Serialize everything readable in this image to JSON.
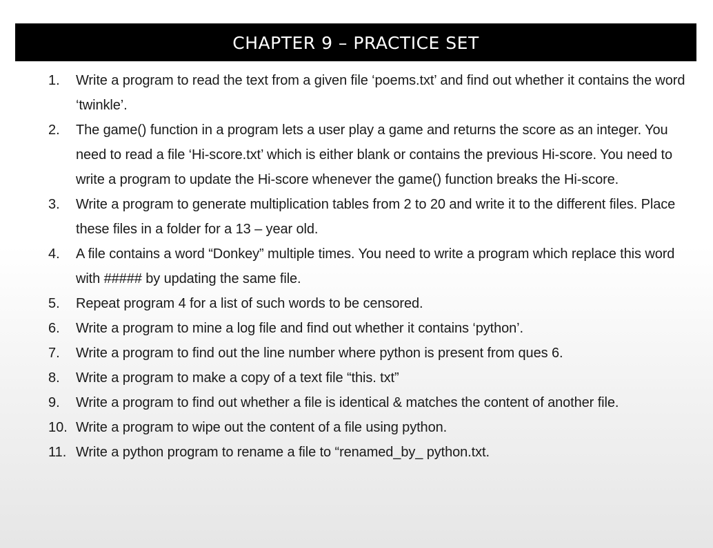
{
  "title": "CHAPTER 9 – PRACTICE SET",
  "questions": [
    {
      "number": "1.",
      "text": "Write a program to read the text from a given file ‘poems.txt’ and find out whether it contains the word ‘twinkle’."
    },
    {
      "number": "2.",
      "text": "The game() function in a program lets a user play a game and returns the score as an integer. You need to read a file ‘Hi-score.txt’ which is either blank or contains the previous Hi-score. You need to write a program to update the Hi-score whenever the game() function breaks the Hi-score."
    },
    {
      "number": "3.",
      "text": "Write a program to generate multiplication tables from 2 to 20 and write it to the different files. Place these files in a folder for a 13 – year old."
    },
    {
      "number": "4.",
      "text": "A file contains a word “Donkey” multiple times. You need to write a program which replace this word with ##### by updating the same file."
    },
    {
      "number": "5.",
      "text": "Repeat program 4 for a list of such words to be censored."
    },
    {
      "number": "6.",
      "text": "Write a program to mine a log file and find out whether it contains ‘python’."
    },
    {
      "number": "7.",
      "text": "Write a program to find out the line number where python is present from ques 6."
    },
    {
      "number": "8.",
      "text": "Write a program to make a copy of a text file “this. txt”"
    },
    {
      "number": "9.",
      "text": "Write a program to find out whether a file is identical & matches the content of another file."
    },
    {
      "number": "10.",
      "text": "Write a program to wipe out the content of a file using python."
    },
    {
      "number": "11.",
      "text": "Write a python program to rename a file to “renamed_by_ python.txt."
    }
  ]
}
